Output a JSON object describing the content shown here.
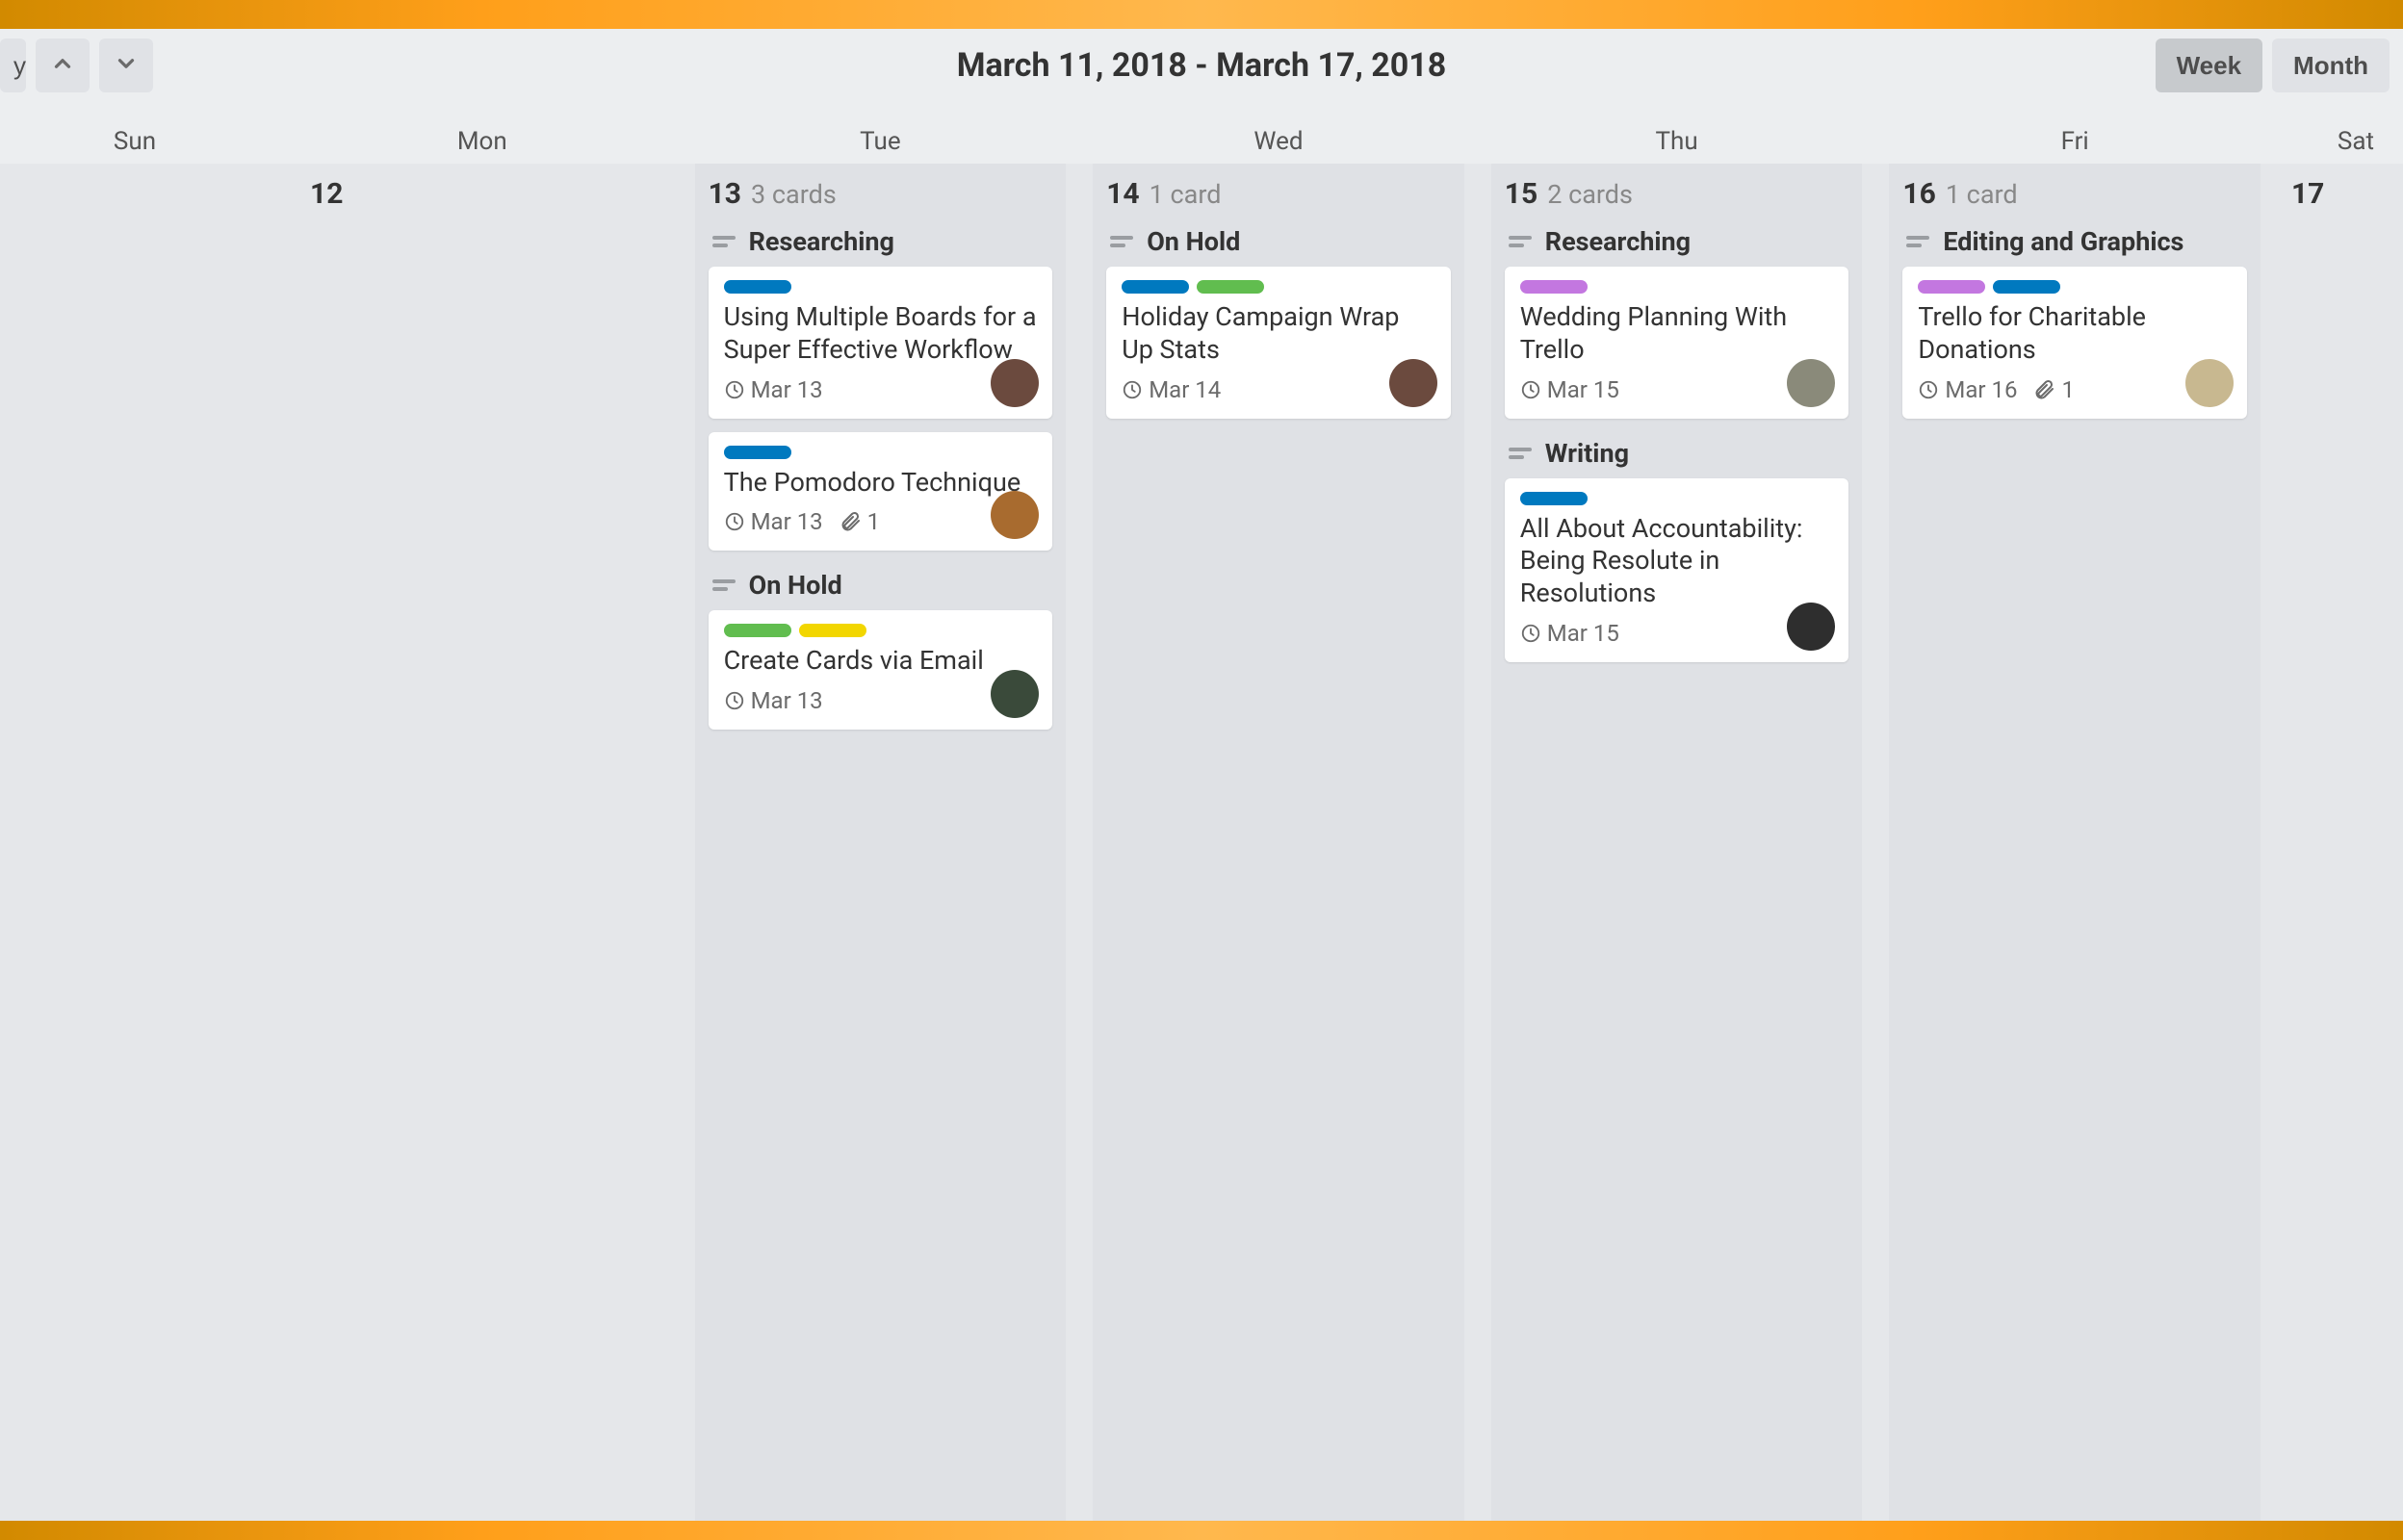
{
  "header": {
    "today_label": "y",
    "date_range": "March 11, 2018 - March 17, 2018",
    "view_week": "Week",
    "view_month": "Month",
    "active_view": "week"
  },
  "day_labels": [
    "Sun",
    "Mon",
    "Tue",
    "Wed",
    "Thu",
    "Fri",
    "Sat"
  ],
  "days": [
    {
      "num": "",
      "count": "",
      "groups": []
    },
    {
      "num": "12",
      "count": "",
      "groups": []
    },
    {
      "num": "13",
      "count": "3 cards",
      "groups": [
        {
          "name": "Researching",
          "cards": [
            {
              "labels": [
                "blue"
              ],
              "title": "Using Multiple Boards for a Super Effective Workflow",
              "date": "Mar 13",
              "attach": "",
              "avatar_color": "#6b4a3e"
            },
            {
              "labels": [
                "blue"
              ],
              "title": "The Pomodoro Technique",
              "date": "Mar 13",
              "attach": "1",
              "avatar_color": "#a86b2f"
            }
          ]
        },
        {
          "name": "On Hold",
          "cards": [
            {
              "labels": [
                "green",
                "yellow"
              ],
              "title": "Create Cards via Email",
              "date": "Mar 13",
              "attach": "",
              "avatar_color": "#3a4a3a"
            }
          ]
        }
      ]
    },
    {
      "num": "14",
      "count": "1 card",
      "groups": [
        {
          "name": "On Hold",
          "cards": [
            {
              "labels": [
                "blue",
                "green"
              ],
              "title": "Holiday Campaign Wrap Up Stats",
              "date": "Mar 14",
              "attach": "",
              "avatar_color": "#6b4a3e"
            }
          ]
        }
      ]
    },
    {
      "num": "15",
      "count": "2 cards",
      "groups": [
        {
          "name": "Researching",
          "cards": [
            {
              "labels": [
                "purple"
              ],
              "title": "Wedding Planning With Trello",
              "date": "Mar 15",
              "attach": "",
              "avatar_color": "#8a8a7a"
            }
          ]
        },
        {
          "name": "Writing",
          "cards": [
            {
              "labels": [
                "blue"
              ],
              "title": "All About Accountability: Being Resolute in Resolutions",
              "date": "Mar 15",
              "attach": "",
              "avatar_color": "#2e2e2e"
            }
          ]
        }
      ]
    },
    {
      "num": "16",
      "count": "1 card",
      "groups": [
        {
          "name": "Editing and Graphics",
          "cards": [
            {
              "labels": [
                "purple",
                "blue"
              ],
              "title": "Trello for Charitable Donations",
              "date": "Mar 16",
              "attach": "1",
              "avatar_color": "#c8b890"
            }
          ]
        }
      ]
    },
    {
      "num": "17",
      "count": "",
      "groups": []
    }
  ]
}
